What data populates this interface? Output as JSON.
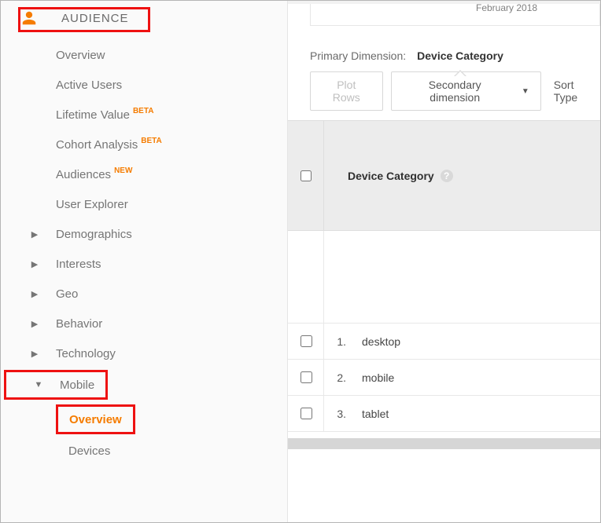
{
  "nav": {
    "section": "AUDIENCE",
    "items": [
      {
        "label": "Overview",
        "arrow": "",
        "badge": ""
      },
      {
        "label": "Active Users",
        "arrow": "",
        "badge": ""
      },
      {
        "label": "Lifetime Value",
        "arrow": "",
        "badge": "BETA"
      },
      {
        "label": "Cohort Analysis",
        "arrow": "",
        "badge": "BETA"
      },
      {
        "label": "Audiences",
        "arrow": "",
        "badge": "NEW"
      },
      {
        "label": "User Explorer",
        "arrow": "",
        "badge": ""
      },
      {
        "label": "Demographics",
        "arrow": "▶",
        "badge": ""
      },
      {
        "label": "Interests",
        "arrow": "▶",
        "badge": ""
      },
      {
        "label": "Geo",
        "arrow": "▶",
        "badge": ""
      },
      {
        "label": "Behavior",
        "arrow": "▶",
        "badge": ""
      },
      {
        "label": "Technology",
        "arrow": "▶",
        "badge": ""
      }
    ],
    "mobile": {
      "label": "Mobile",
      "arrow": "▼"
    },
    "mobile_children": [
      {
        "label": "Overview"
      },
      {
        "label": "Devices"
      }
    ]
  },
  "chart": {
    "month": "February 2018"
  },
  "dimension": {
    "label": "Primary Dimension:",
    "active": "Device Category"
  },
  "controls": {
    "plot_rows": "Plot Rows",
    "secondary": "Secondary dimension",
    "sort": "Sort Type"
  },
  "table": {
    "header": "Device Category",
    "help": "?",
    "rows": [
      {
        "n": "1.",
        "val": "desktop"
      },
      {
        "n": "2.",
        "val": "mobile"
      },
      {
        "n": "3.",
        "val": "tablet"
      }
    ]
  }
}
